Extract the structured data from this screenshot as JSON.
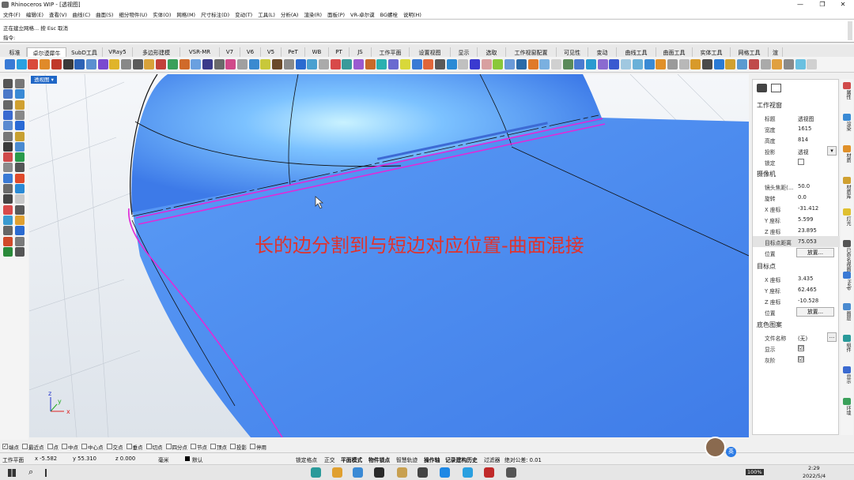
{
  "window": {
    "title": "Rhinoceros WIP - [透视图]",
    "controls": [
      "—",
      "❐",
      "✕"
    ]
  },
  "menu": [
    "文件(F)",
    "编辑(E)",
    "查看(V)",
    "曲线(C)",
    "曲面(S)",
    "细分物件(U)",
    "实体(O)",
    "网格(M)",
    "尺寸标注(D)",
    "变动(T)",
    "工具(L)",
    "分析(A)",
    "渲染(R)",
    "面板(P)",
    "VR-卓尔谟",
    "BG螺栓",
    "说明(H)"
  ],
  "command": {
    "history": "正在建立网格... 按 Esc 取消",
    "prompt_label": "指令:",
    "input_value": ""
  },
  "tabs": [
    "标准",
    "卓尔谟犀牛",
    "SubD工具",
    "VRay5",
    "多边形建模",
    "VSR-MR",
    "V7",
    "V6",
    "V5",
    "PeT",
    "WB",
    "PT",
    "JS",
    "工作平面",
    "设置视图",
    "显示",
    "选取",
    "工作视窗配置",
    "可见性",
    "变动",
    "曲线工具",
    "曲面工具",
    "实体工具",
    "网格工具",
    "渲"
  ],
  "active_tab": "卓尔谟犀牛",
  "viewport": {
    "tab_label": "透视图",
    "caption": "长的边分割到与短边对应位置-曲面混接",
    "axis_labels": {
      "x": "x",
      "y": "y",
      "z": "z"
    }
  },
  "properties": {
    "section_viewport": "工作视窗",
    "viewport_rows": [
      {
        "k": "标题",
        "v": "透视图"
      },
      {
        "k": "宽度",
        "v": "1615"
      },
      {
        "k": "高度",
        "v": "814"
      },
      {
        "k": "投影",
        "v": "透视"
      },
      {
        "k": "锁定",
        "v": ""
      }
    ],
    "section_camera": "摄像机",
    "camera_rows": [
      {
        "k": "镜头焦距(...",
        "v": "50.0"
      },
      {
        "k": "旋转",
        "v": "0.0"
      },
      {
        "k": "X 座标",
        "v": "-31.412"
      },
      {
        "k": "Y 座标",
        "v": "5.599"
      },
      {
        "k": "Z 座标",
        "v": "23.895"
      },
      {
        "k": "目标点距离",
        "v": "75.053"
      },
      {
        "k": "位置",
        "v": "放置..."
      }
    ],
    "section_target": "目标点",
    "target_rows": [
      {
        "k": "X 座标",
        "v": "3.435"
      },
      {
        "k": "Y 座标",
        "v": "62.465"
      },
      {
        "k": "Z 座标",
        "v": "-10.528"
      },
      {
        "k": "位置",
        "v": "放置..."
      }
    ],
    "section_bg": "底色图案",
    "bg_rows": [
      {
        "k": "文件名称",
        "v": "(无)"
      },
      {
        "k": "显示",
        "v": "☑"
      },
      {
        "k": "灰阶",
        "v": "☑"
      }
    ],
    "ellipsis": "...",
    "dropdown_arrow": "▾"
  },
  "right_strip": [
    "属性",
    "渲染",
    "材质",
    "材质库",
    "灯光",
    "已命名视图",
    "Help",
    "图层",
    "组件",
    "显示",
    "环境"
  ],
  "osnap": [
    {
      "label": "端点",
      "checked": true
    },
    {
      "label": "最近点",
      "checked": false
    },
    {
      "label": "点",
      "checked": false
    },
    {
      "label": "中点",
      "checked": false
    },
    {
      "label": "中心点",
      "checked": false
    },
    {
      "label": "交点",
      "checked": false
    },
    {
      "label": "垂点",
      "checked": false
    },
    {
      "label": "切点",
      "checked": false
    },
    {
      "label": "四分点",
      "checked": false
    },
    {
      "label": "节点",
      "checked": false
    },
    {
      "label": "顶点",
      "checked": false
    },
    {
      "label": "投影",
      "checked": false
    },
    {
      "label": "停用",
      "checked": false
    }
  ],
  "status": {
    "cplane": "工作平面",
    "x": "x -5.582",
    "y": "y 55.310",
    "z": "z 0.000",
    "unit": "毫米",
    "layer": "默认",
    "grid_snap": "锁定格点",
    "ortho": "正交",
    "planar": "平面模式",
    "osnap": "物件锁点",
    "smarttrack": "智慧轨迹",
    "gumball": "操作轴",
    "history": "记录建构历史",
    "filter": "过滤器",
    "tolerance": "绝对公差: 0.01"
  },
  "taskbar": {
    "search_icon": "⌕",
    "lang": "英",
    "battery": "100%",
    "time": "2:29",
    "date": "2022/5/4"
  },
  "colors": {
    "accent": "#1f66c6",
    "caption": "#e0332d",
    "surface": "#4f8df0",
    "highlight": "#e02ad8"
  }
}
